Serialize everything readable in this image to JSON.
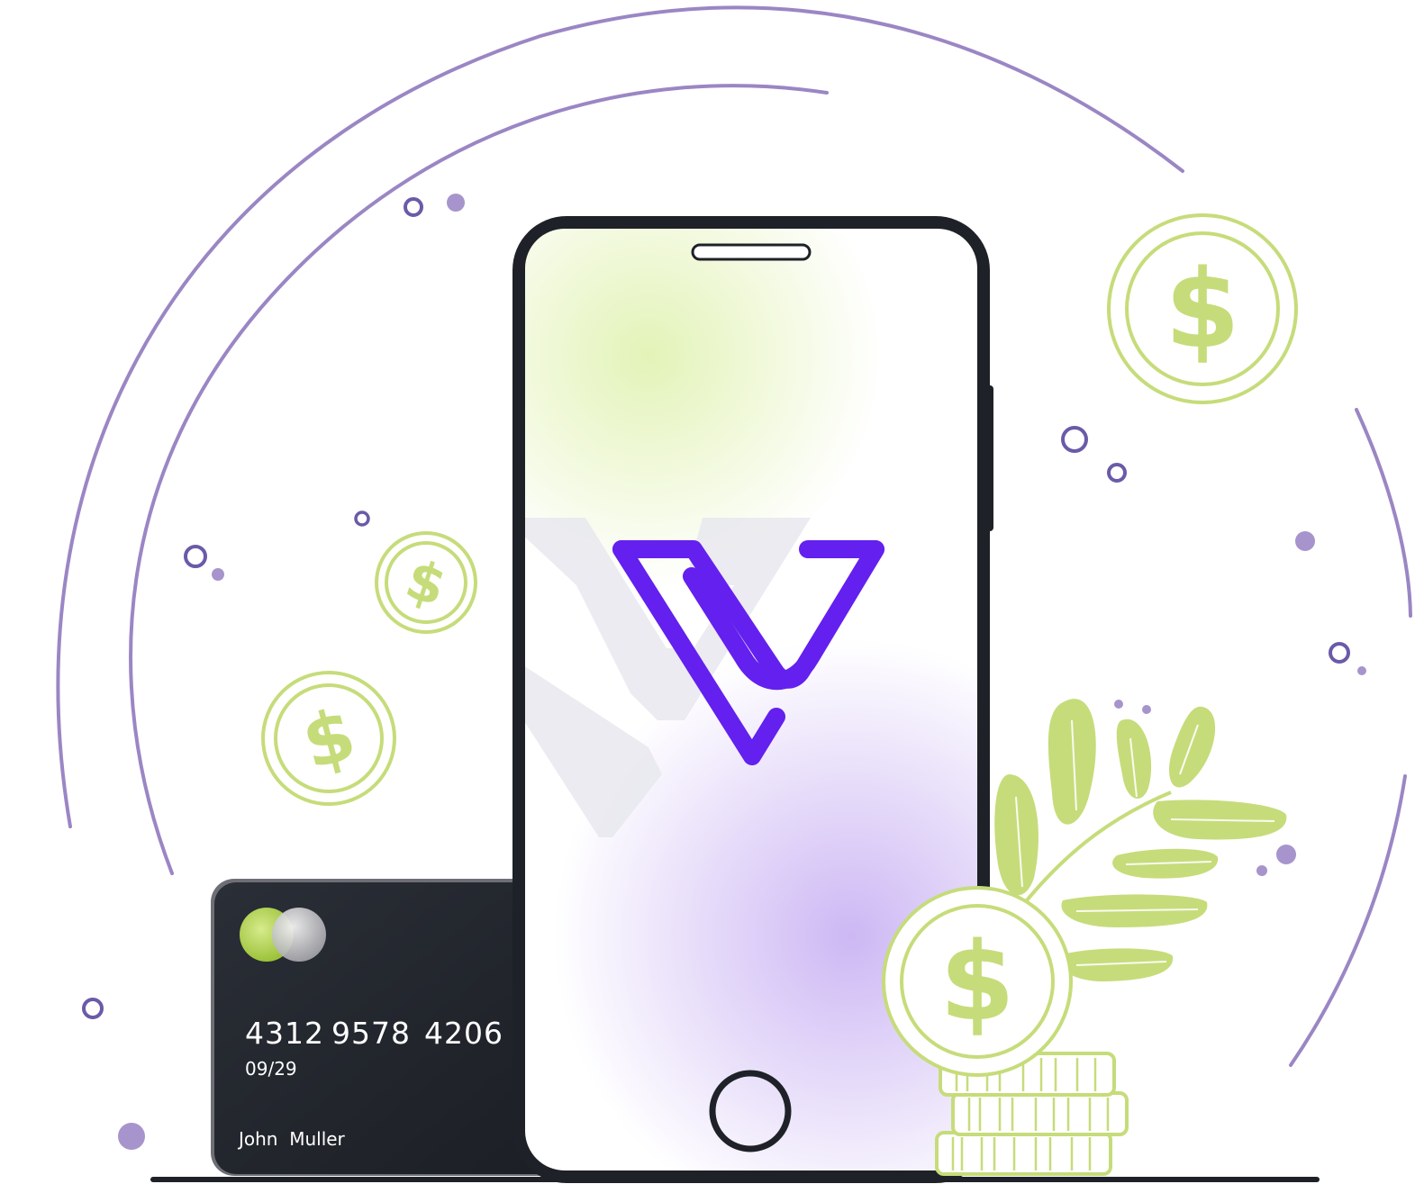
{
  "card": {
    "number_groups": [
      "4312",
      "9578",
      "4206"
    ],
    "expiry": "09/29",
    "holder": "John  Muller"
  },
  "coins": {
    "symbol": "$"
  },
  "colors": {
    "purple_arc": "#9b86c4",
    "lime": "#c6dc7a",
    "brand": "#6320ee",
    "phone_frame": "#1e2127",
    "card_bg": "#1e2127",
    "dot_dark": "#6b5aa8"
  },
  "icons": {
    "logo": "v-brand-logo-icon",
    "home_button": "home-button-icon",
    "speaker": "speaker-grille-icon",
    "card_chip": "card-network-circles-icon"
  }
}
